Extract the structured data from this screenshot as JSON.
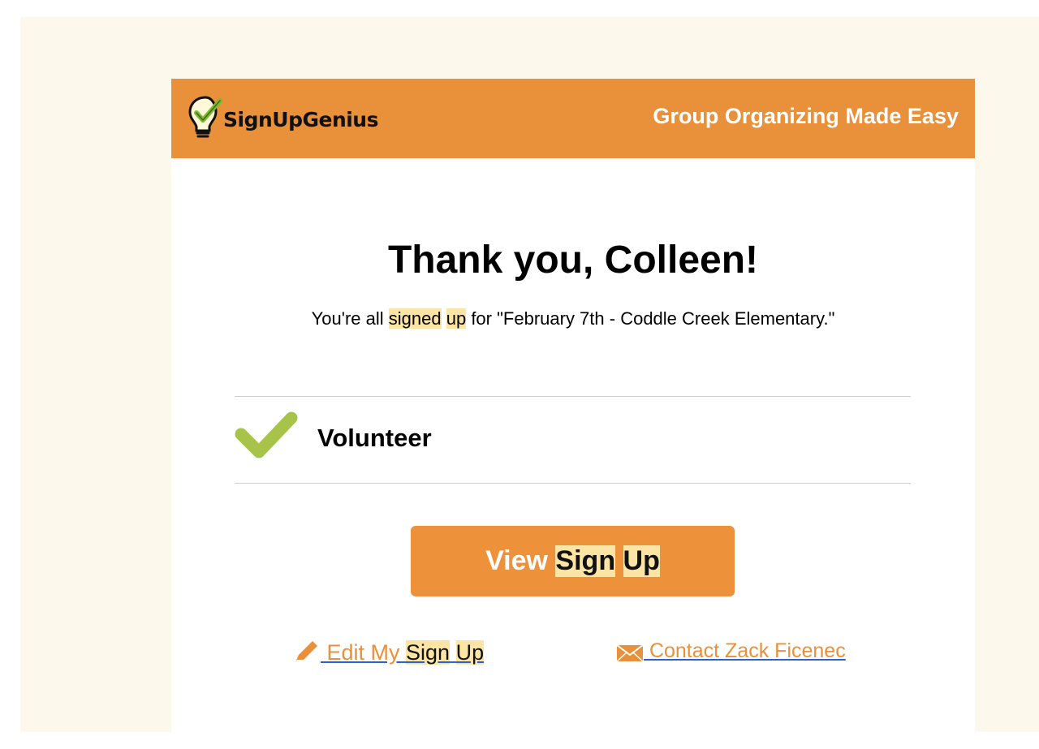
{
  "header": {
    "logo_text": "SignUpGenius",
    "tagline": "Group Organizing Made Easy"
  },
  "main": {
    "title": "Thank you, Colleen!",
    "subtitle_pre": "You're all ",
    "subtitle_hl1": "signed",
    "subtitle_space": " ",
    "subtitle_hl2": "up",
    "subtitle_post": " for \"February 7th - Coddle Creek Elementary.\"",
    "item_label": "Volunteer"
  },
  "actions": {
    "view_prefix": "View ",
    "view_hl1": "Sign",
    "view_hl2": "Up",
    "edit_prefix": " Edit My ",
    "edit_hl1": "Sign",
    "edit_hl2": "Up",
    "contact_label": " Contact Zack Ficenec"
  },
  "colors": {
    "header_bg": "#e8903a",
    "button_bg": "#ed913b",
    "page_bg": "#fdf8ec",
    "highlight": "#fbe4a4",
    "check_green": "#a8c34a"
  },
  "icons": [
    "lightbulb-logo-icon",
    "checkmark-icon",
    "pencil-icon",
    "envelope-icon"
  ]
}
